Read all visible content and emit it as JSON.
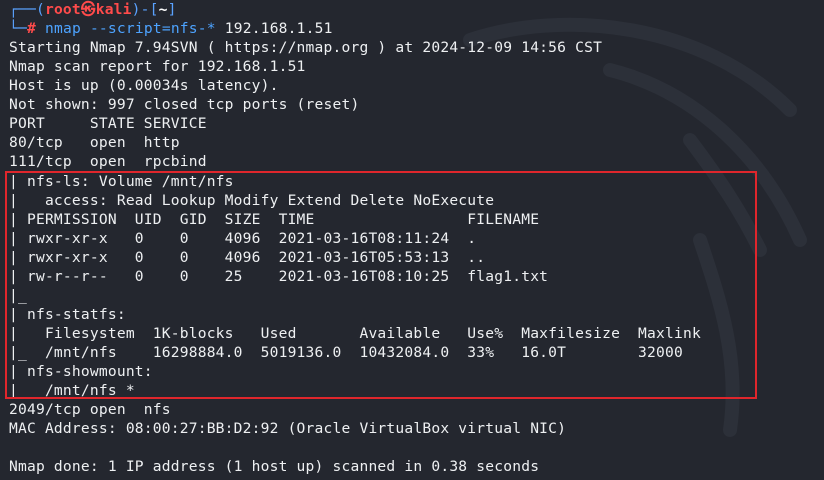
{
  "prompt": {
    "bracket_open": "┌──(",
    "user": "root",
    "at_symbol": "㉿",
    "host": "kali",
    "bracket_mid": ")-[",
    "cwd": "~",
    "bracket_close": "]",
    "second_line_prefix": "└─",
    "hash": "#",
    "command_bin": "nmap",
    "command_arg": "--script=nfs-",
    "command_star": "*",
    "command_target": "192.168.1.51"
  },
  "output_lines": [
    "Starting Nmap 7.94SVN ( https://nmap.org ) at 2024-12-09 14:56 CST",
    "Nmap scan report for 192.168.1.51",
    "Host is up (0.00034s latency).",
    "Not shown: 997 closed tcp ports (reset)",
    "PORT     STATE SERVICE",
    "80/tcp   open  http",
    "111/tcp  open  rpcbind",
    "| nfs-ls: Volume /mnt/nfs",
    "|   access: Read Lookup Modify Extend Delete NoExecute",
    "| PERMISSION  UID  GID  SIZE  TIME                 FILENAME",
    "| rwxr-xr-x   0    0    4096  2021-03-16T08:11:24  .",
    "| rwxr-xr-x   0    0    4096  2021-03-16T05:53:13  ..",
    "| rw-r--r--   0    0    25    2021-03-16T08:10:25  flag1.txt",
    "|_",
    "| nfs-statfs:",
    "|   Filesystem  1K-blocks   Used       Available   Use%  Maxfilesize  Maxlink",
    "|_  /mnt/nfs    16298884.0  5019136.0  10432084.0  33%   16.0T        32000",
    "| nfs-showmount:",
    "|_  /mnt/nfs *",
    "2049/tcp open  nfs",
    "MAC Address: 08:00:27:BB:D2:92 (Oracle VirtualBox virtual NIC)",
    "",
    "Nmap done: 1 IP address (1 host up) scanned in 0.38 seconds"
  ],
  "colors": {
    "background": "#24272f",
    "text": "#eef0f2",
    "prompt_frame": "#5aa2ff",
    "prompt_user": "#ff4b4b",
    "command": "#4da3ff",
    "highlight_border": "#e0262c"
  }
}
